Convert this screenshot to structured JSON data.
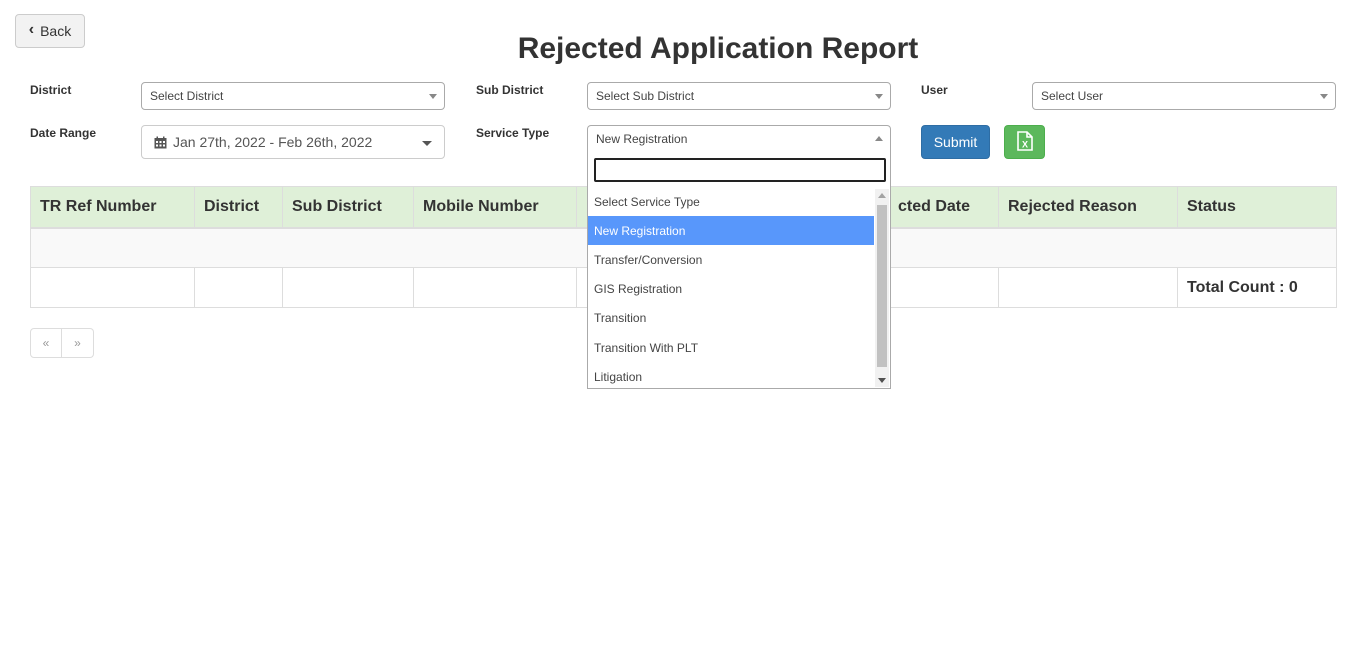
{
  "header": {
    "back_label": "Back",
    "title": "Rejected Application Report"
  },
  "filters": {
    "district": {
      "label": "District",
      "value": "Select District"
    },
    "sub_district": {
      "label": "Sub District",
      "value": "Select Sub District"
    },
    "user": {
      "label": "User",
      "value": "Select User"
    },
    "date_range": {
      "label": "Date Range",
      "value": "Jan 27th, 2022 - Feb 26th, 2022"
    },
    "service_type": {
      "label": "Service Type",
      "value": "New Registration",
      "search_value": "",
      "options": [
        "Select Service Type",
        "New Registration",
        "Transfer/Conversion",
        "GIS Registration",
        "Transition",
        "Transition With PLT",
        "Litigation"
      ],
      "selected_index": 1
    }
  },
  "actions": {
    "submit_label": "Submit",
    "export_icon": "excel-file-icon",
    "export_color": "#5cb85c",
    "submit_color": "#337ab7"
  },
  "table": {
    "columns": [
      "TR Ref Number",
      "District",
      "Sub District",
      "Mobile Number",
      "",
      "",
      "Rejected Date",
      "Rejected Reason",
      "Status"
    ],
    "visible_rejected_date_fragment": "cted Date",
    "rows": [],
    "total_count": "Total Count : 0",
    "header_color": "#dff0d8"
  },
  "pagination": {
    "prev": "«",
    "next": "»"
  }
}
